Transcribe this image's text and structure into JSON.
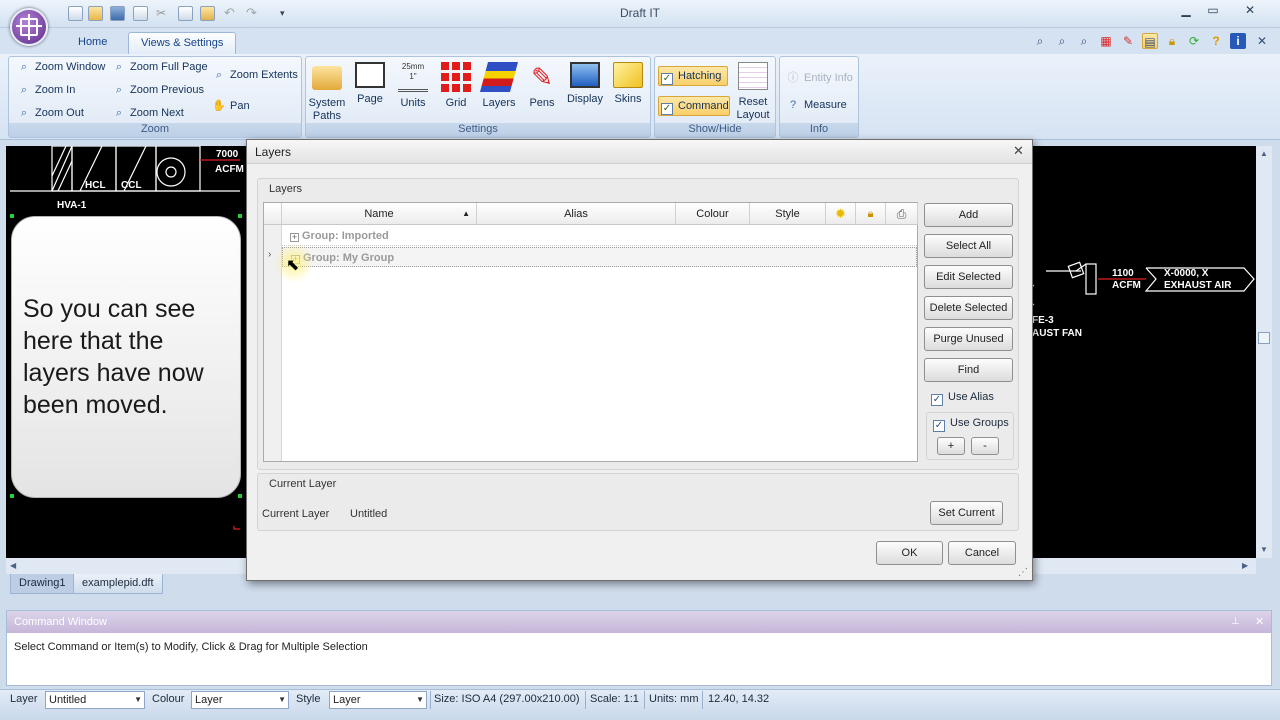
{
  "app": {
    "title": "Draft IT"
  },
  "tabs": [
    {
      "label": "Home"
    },
    {
      "label": "Views & Settings"
    }
  ],
  "ribbon": {
    "zoom_group": {
      "caption": "Zoom",
      "items": [
        "Zoom Window",
        "Zoom In",
        "Zoom Out",
        "Zoom Full Page",
        "Zoom Previous",
        "Zoom Next",
        "Zoom Extents",
        "Pan"
      ]
    },
    "settings_group": {
      "caption": "Settings",
      "items": [
        {
          "label": "System Paths"
        },
        {
          "label": "Page"
        },
        {
          "label": "Units"
        },
        {
          "label": "Grid"
        },
        {
          "label": "Layers"
        },
        {
          "label": "Pens"
        },
        {
          "label": "Display"
        },
        {
          "label": "Skins"
        }
      ],
      "units_icon_text": "25mm",
      "units_icon_text2": "1\""
    },
    "showhide_group": {
      "caption": "Show/Hide",
      "hatching": "Hatching",
      "command": "Command",
      "reset_layout": "Reset Layout"
    },
    "info_group": {
      "caption": "Info",
      "entity_info": "Entity Info",
      "measure": "Measure"
    }
  },
  "drawing": {
    "labels": [
      "7000",
      "ACFM",
      "HCL",
      "CCL",
      "HVA-1",
      "1100",
      "ACFM",
      "X-0000, X",
      "EXHAUST AIR",
      "FE-3",
      "AUST FAN"
    ]
  },
  "callout": {
    "text": "So you can see here that the layers have now been moved."
  },
  "doc_tabs": [
    "Drawing1",
    "examplepid.dft"
  ],
  "dialog": {
    "title": "Layers",
    "layers_panel": {
      "caption": "Layers"
    },
    "columns": [
      "Name",
      "Alias",
      "Colour",
      "Style"
    ],
    "rows": [
      {
        "label": "Group: Imported"
      },
      {
        "label": "Group: My Group"
      }
    ],
    "buttons": [
      "Add",
      "Select All",
      "Edit Selected",
      "Delete Selected",
      "Purge Unused",
      "Find"
    ],
    "use_alias": "Use Alias",
    "use_groups": "Use Groups",
    "plus": "+",
    "minus": "-",
    "current_panel": {
      "caption": "Current Layer",
      "label": "Current Layer",
      "value": "Untitled",
      "set_current": "Set Current"
    },
    "ok": "OK",
    "cancel": "Cancel"
  },
  "command_window": {
    "title": "Command Window",
    "text": "Select Command or Item(s) to Modify, Click & Drag for Multiple Selection"
  },
  "status_bar": {
    "layer_label": "Layer",
    "layer_value": "Untitled",
    "colour_label": "Colour",
    "colour_value": "Layer",
    "style_label": "Style",
    "style_value": "Layer",
    "size": "Size: ISO A4 (297.00x210.00)",
    "scale": "Scale: 1:1",
    "units": "Units: mm",
    "coords": "12.40, 14.32"
  },
  "colors": {
    "accent": "#15428b",
    "highlight": "#fbcf6a",
    "drawing_bg": "#000000",
    "cad_red": "#e02020"
  }
}
